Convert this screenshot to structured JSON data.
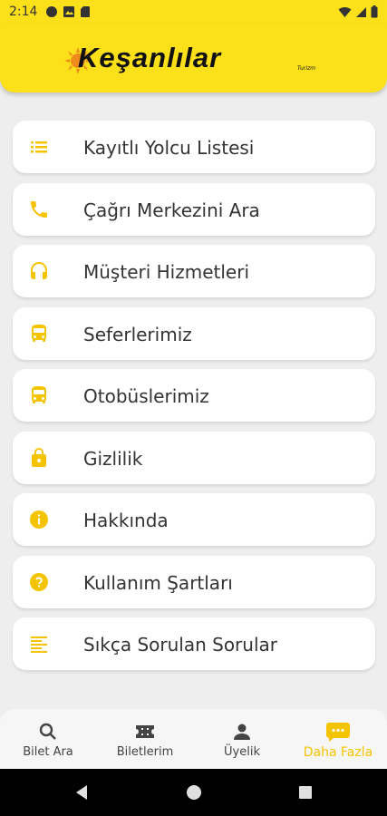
{
  "status_bar": {
    "time": "2:14"
  },
  "brand": {
    "name": "Keşanlılar",
    "tagline": "Turizm"
  },
  "menu": {
    "items": [
      {
        "label": "Kayıtlı Yolcu Listesi",
        "icon": "list-icon"
      },
      {
        "label": "Çağrı Merkezini Ara",
        "icon": "phone-icon"
      },
      {
        "label": "Müşteri Hizmetleri",
        "icon": "headset-icon"
      },
      {
        "label": "Seferlerimiz",
        "icon": "bus-icon"
      },
      {
        "label": "Otobüslerimiz",
        "icon": "bus-icon"
      },
      {
        "label": "Gizlilik",
        "icon": "lock-icon"
      },
      {
        "label": "Hakkında",
        "icon": "info-icon"
      },
      {
        "label": "Kullanım Şartları",
        "icon": "help-icon"
      },
      {
        "label": "Sıkça Sorulan Sorular",
        "icon": "notes-icon"
      }
    ]
  },
  "bottom_nav": {
    "items": [
      {
        "label": "Bilet Ara",
        "icon": "search-icon"
      },
      {
        "label": "Biletlerim",
        "icon": "ticket-icon"
      },
      {
        "label": "Üyelik",
        "icon": "person-icon"
      },
      {
        "label": "Daha Fazla",
        "icon": "more-chat-icon",
        "active": true
      }
    ]
  },
  "colors": {
    "accent": "#fbe01a",
    "icon_yellow": "#f5c400",
    "background": "#eeeeee"
  }
}
